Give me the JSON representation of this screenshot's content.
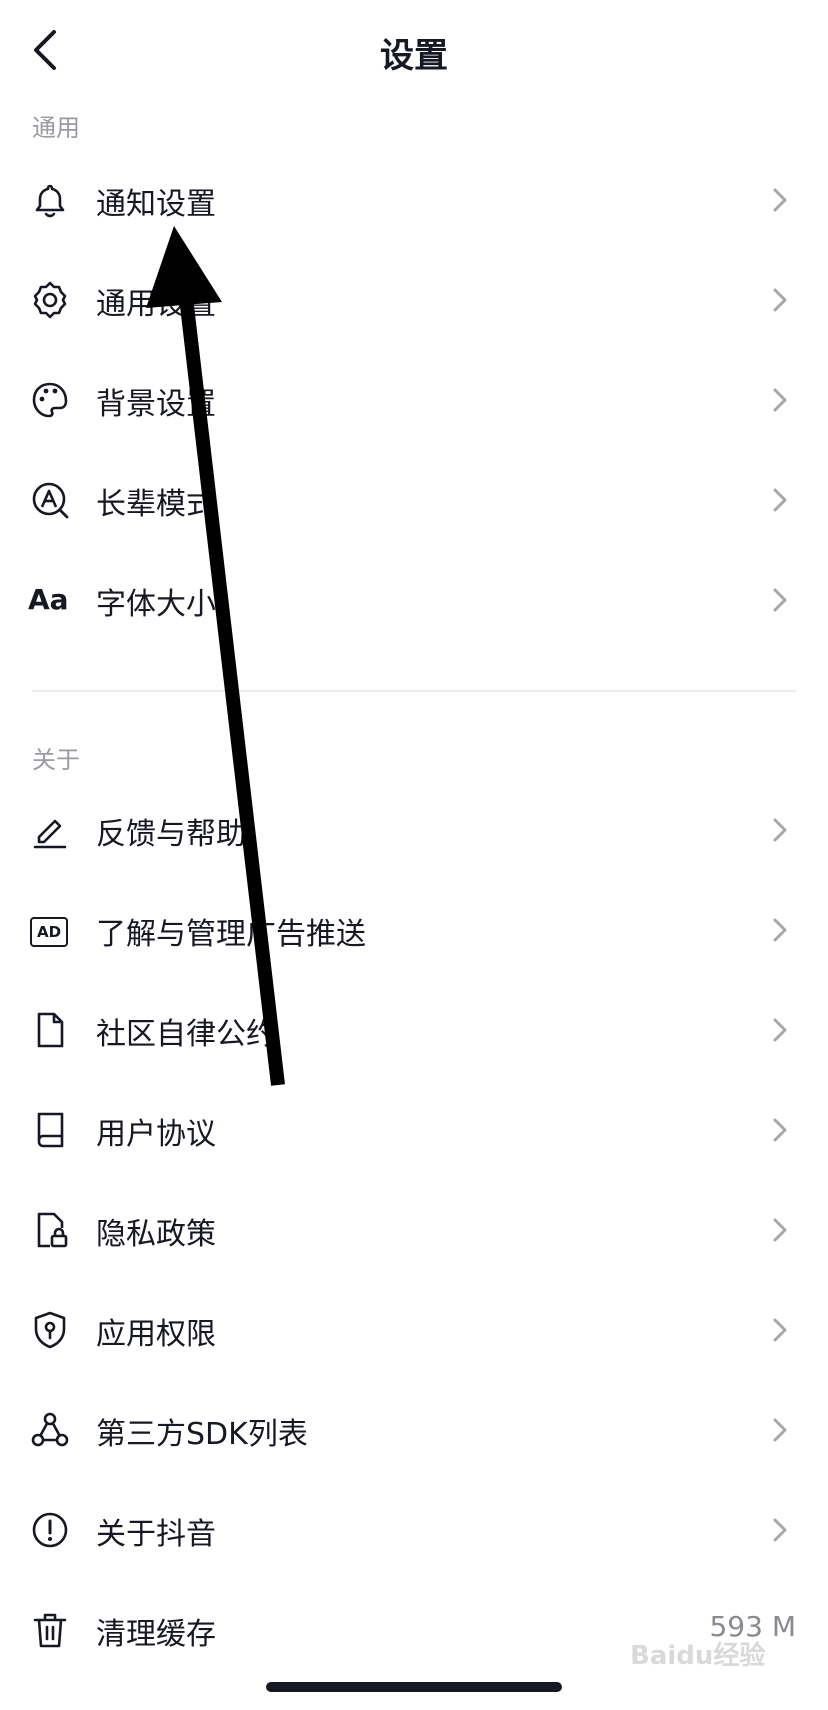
{
  "header": {
    "title": "设置",
    "back_icon": "chevron-left-icon"
  },
  "sections": {
    "general": {
      "title": "通用"
    },
    "about": {
      "title": "关于"
    }
  },
  "general_items": [
    {
      "label": "通知设置",
      "icon": "bell-icon"
    },
    {
      "label": "通用设置",
      "icon": "gear-icon"
    },
    {
      "label": "背景设置",
      "icon": "palette-icon"
    },
    {
      "label": "长辈模式",
      "icon": "elder-mode-icon"
    },
    {
      "label": "字体大小",
      "icon": "font-size-icon"
    }
  ],
  "about_items": [
    {
      "label": "反馈与帮助",
      "icon": "pencil-icon"
    },
    {
      "label": "了解与管理广告推送",
      "icon": "ad-icon"
    },
    {
      "label": "社区自律公约",
      "icon": "document-icon"
    },
    {
      "label": "用户协议",
      "icon": "book-icon"
    },
    {
      "label": "隐私政策",
      "icon": "privacy-lock-icon"
    },
    {
      "label": "应用权限",
      "icon": "shield-icon"
    },
    {
      "label": "第三方SDK列表",
      "icon": "sdk-icon"
    },
    {
      "label": "关于抖音",
      "icon": "info-icon"
    },
    {
      "label": "清理缓存",
      "icon": "trash-icon",
      "value": "593 M"
    }
  ],
  "icon_font_size_text": "Aa",
  "icon_ad_text": "AD",
  "watermark_text": "Baidu经验",
  "colors": {
    "text": "#161823",
    "secondary": "#9a9ba0",
    "chevron": "#a7a8ad",
    "divider": "#ececee"
  }
}
